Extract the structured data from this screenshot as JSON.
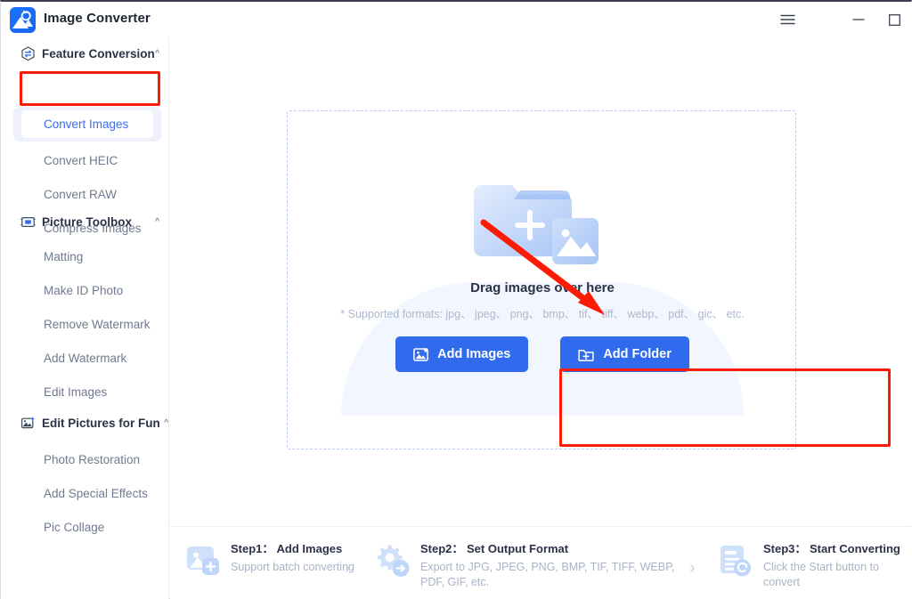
{
  "window": {
    "app_title": "Image Converter",
    "logo_icon": "image-convert-logo-icon",
    "controls": [
      {
        "name": "menu-button",
        "icon": "hamburger-menu-icon",
        "label": "☰"
      },
      {
        "name": "minimize-button",
        "icon": "minimize-icon",
        "label": "—"
      },
      {
        "name": "maximize-button",
        "icon": "maximize-icon",
        "label": "□"
      },
      {
        "name": "close-button",
        "icon": "close-icon",
        "label": "✕"
      }
    ]
  },
  "sidebar": {
    "sections": [
      {
        "label": "Feature Conversion",
        "icon": "hexagon-convert-icon",
        "caret": "^",
        "expanded": true,
        "items": [
          {
            "label": "Convert Images",
            "active": true
          },
          {
            "label": "Convert HEIC",
            "active": false
          },
          {
            "label": "Convert RAW",
            "active": false
          },
          {
            "label": "Compress Images",
            "active": false
          }
        ]
      },
      {
        "label": "Picture Toolbox",
        "icon": "picture-toolbox-icon",
        "caret": "^",
        "expanded": true,
        "items": [
          {
            "label": "Matting",
            "active": false
          },
          {
            "label": "Make ID Photo",
            "active": false
          },
          {
            "label": "Remove Watermark",
            "active": false
          },
          {
            "label": "Add Watermark",
            "active": false
          },
          {
            "label": "Edit Images",
            "active": false
          }
        ]
      },
      {
        "label": "Edit Pictures for Fun",
        "icon": "sparkle-picture-icon",
        "caret": "^",
        "expanded": true,
        "items": [
          {
            "label": "Photo Restoration",
            "active": false
          },
          {
            "label": "Add Special Effects",
            "active": false
          },
          {
            "label": "Pic Collage",
            "active": false
          }
        ]
      }
    ]
  },
  "dropzone": {
    "illustration_icon": "folder-plus-image-icon",
    "title": "Drag images over here",
    "supported_formats": "* Supported formats: jpg、 jpeg、 png、 bmp、 tif、 tiff、 webp、 pdf、 gic、 etc.",
    "add_images_button": {
      "label": "Add Images",
      "icon": "add-image-icon"
    },
    "add_folder_button": {
      "label": "Add Folder",
      "icon": "add-folder-icon"
    }
  },
  "annotations": {
    "accent_color": "#fe1b06",
    "arrow": "red-arrow-pointing-to-dropzone",
    "boxes": [
      "convert-images-nav-item",
      "add-buttons-row"
    ]
  },
  "steps": {
    "separator": "›",
    "items": [
      {
        "title": "Step1： Add Images",
        "desc": "Support batch converting",
        "icon": "add-image-step-icon"
      },
      {
        "title": "Step2： Set Output Format",
        "desc": "Export to JPG, JPEG, PNG, BMP, TIF, TIFF, WEBP, PDF, GIF, etc.",
        "icon": "gear-arrow-step-icon"
      },
      {
        "title": "Step3： Start Converting",
        "desc": "Click the Start button to convert",
        "icon": "document-refresh-step-icon"
      }
    ]
  },
  "colors": {
    "primary_blue": "#2f6bec",
    "active_text": "#3b6cf0",
    "active_band": "#eef1fb",
    "muted_text": "#aeb8cc",
    "dash_border": "#b9ccf5"
  }
}
